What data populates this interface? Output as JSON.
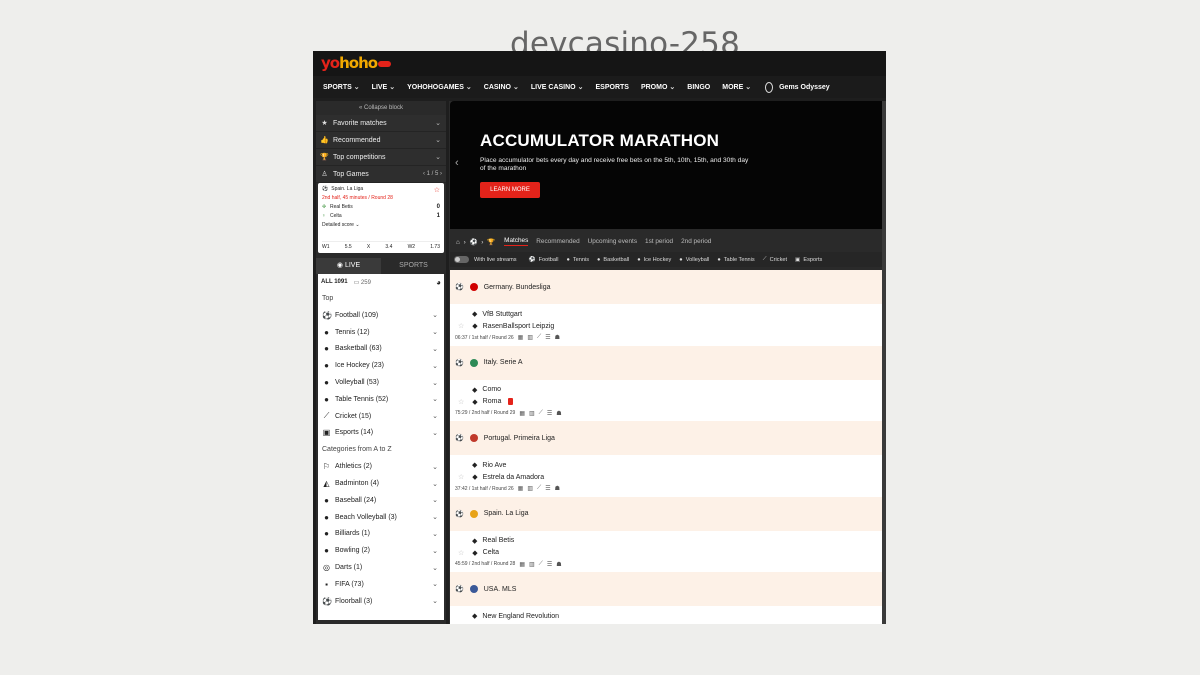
{
  "page_label": "devcasino-258",
  "logo": {
    "text_a": "yo",
    "text_b": "hoho"
  },
  "nav": {
    "items": [
      {
        "label": "SPORTS",
        "chevron": true
      },
      {
        "label": "LIVE",
        "chevron": true
      },
      {
        "label": "YOHOHOGAMES",
        "chevron": true
      },
      {
        "label": "CASINO",
        "chevron": true
      },
      {
        "label": "LIVE CASINO",
        "chevron": true
      },
      {
        "label": "ESPORTS",
        "chevron": false
      },
      {
        "label": "PROMO",
        "chevron": true
      },
      {
        "label": "BINGO",
        "chevron": false
      },
      {
        "label": "MORE",
        "chevron": true
      }
    ],
    "gems_label": "Gems Odyssey"
  },
  "sidebar": {
    "collapse_label": "« Collapse block",
    "sections": [
      {
        "icon": "star-icon",
        "label": "Favorite matches"
      },
      {
        "icon": "thumbs-up-icon",
        "label": "Recommended"
      },
      {
        "icon": "trophy-icon",
        "label": "Top competitions"
      }
    ],
    "top_games": {
      "label": "Top Games",
      "pager": "1 / 5"
    },
    "card": {
      "league": "Spain. La Liga",
      "status": "2nd half, 45 minutes / Round 28",
      "home": "Real Betis",
      "home_score": "0",
      "away": "Celta",
      "away_score": "1",
      "detail_label": "Detailed score",
      "odds": [
        "W1",
        "5.5",
        "X",
        "3.4",
        "W2",
        "1.73"
      ]
    },
    "tabs": {
      "live": "LIVE",
      "sports": "SPORTS"
    },
    "all_label": "ALL 1091",
    "all_count": "259",
    "top_label": "Top",
    "top_sports": [
      {
        "icon": "football-icon",
        "glyph": "⚽",
        "label": "Football (109)"
      },
      {
        "icon": "tennis-icon",
        "glyph": "●",
        "label": "Tennis (12)"
      },
      {
        "icon": "basketball-icon",
        "glyph": "●",
        "label": "Basketball (63)"
      },
      {
        "icon": "ice-hockey-icon",
        "glyph": "●",
        "label": "Ice Hockey (23)"
      },
      {
        "icon": "volleyball-icon",
        "glyph": "●",
        "label": "Volleyball (53)"
      },
      {
        "icon": "table-tennis-icon",
        "glyph": "●",
        "label": "Table Tennis (52)"
      },
      {
        "icon": "cricket-icon",
        "glyph": "⟋",
        "label": "Cricket (15)"
      },
      {
        "icon": "esports-icon",
        "glyph": "▣",
        "label": "Esports (14)"
      }
    ],
    "az_label": "Categories from A to Z",
    "az_sports": [
      {
        "icon": "athletics-icon",
        "glyph": "⚐",
        "label": "Athletics (2)"
      },
      {
        "icon": "badminton-icon",
        "glyph": "◭",
        "label": "Badminton (4)"
      },
      {
        "icon": "baseball-icon",
        "glyph": "●",
        "label": "Baseball (24)"
      },
      {
        "icon": "beach-volleyball-icon",
        "glyph": "●",
        "label": "Beach Volleyball (3)"
      },
      {
        "icon": "billiards-icon",
        "glyph": "●",
        "label": "Billiards (1)"
      },
      {
        "icon": "bowling-icon",
        "glyph": "●",
        "label": "Bowling (2)"
      },
      {
        "icon": "darts-icon",
        "glyph": "◎",
        "label": "Darts (1)"
      },
      {
        "icon": "fifa-icon",
        "glyph": "▪",
        "label": "FIFA (73)"
      },
      {
        "icon": "floorball-icon",
        "glyph": "⚽",
        "label": "Floorball (3)"
      }
    ]
  },
  "banner": {
    "title": "ACCUMULATOR MARATHON",
    "text": "Place accumulator bets every day and receive free bets on the 5th, 10th, 15th, and 30th day of the marathon",
    "cta": "LEARN MORE"
  },
  "crumbs": {
    "tabs": [
      "Matches",
      "Recommended",
      "Upcoming events",
      "1st period",
      "2nd period"
    ]
  },
  "filters": {
    "live_streams": "With live streams",
    "sports": [
      "Football",
      "Tennis",
      "Basketball",
      "Ice Hockey",
      "Volleyball",
      "Table Tennis",
      "Cricket",
      "Esports"
    ]
  },
  "matches": [
    {
      "league": "Germany. Bundesliga",
      "flag": "#d00000",
      "home": "VfB Stuttgart",
      "away": "RasenBallsport Leipzig",
      "meta": "06:37 / 1st half / Round 26",
      "red_card": false
    },
    {
      "league": "Italy. Serie A",
      "flag": "#2e8b57",
      "home": "Como",
      "away": "Roma",
      "meta": "75:29 / 2nd half / Round 29",
      "red_card": true
    },
    {
      "league": "Portugal. Primeira Liga",
      "flag": "#c0392b",
      "home": "Rio Ave",
      "away": "Estrela da Amadora",
      "meta": "37:42 / 1st half / Round 26",
      "red_card": false
    },
    {
      "league": "Spain. La Liga",
      "flag": "#e8a317",
      "home": "Real Betis",
      "away": "Celta",
      "meta": "45:59 / 2nd half / Round 28",
      "red_card": false
    },
    {
      "league": "USA. MLS",
      "flag": "#3b5998",
      "home": "New England Revolution",
      "away": "",
      "meta": "",
      "red_card": false
    }
  ],
  "colors": {
    "accent": "#e4231a",
    "league_bg": "#fdf1e7"
  }
}
